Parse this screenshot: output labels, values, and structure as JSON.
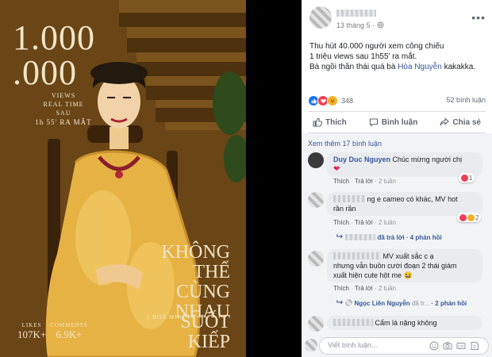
{
  "poster": {
    "big_line1": "1.000",
    "big_line2": ".000",
    "views_label": "VIEWS",
    "realtime_label": "REAL TIME",
    "sau_label": "SAU",
    "time_label": "1h 55' RA MẮT",
    "title_lines": [
      "KHÔNG",
      "THỂ",
      "CÙNG",
      "NHAU",
      "SUỐT",
      "KIẾP"
    ],
    "credit": "[ HOÀ MINZY ]",
    "likes_label": "LIKES",
    "likes_value": "107K+",
    "comments_label": "COMMENTS",
    "comments_value": "6.9K+"
  },
  "post": {
    "date": "13 tháng 5 ·",
    "text_line1": "Thu hút 40.000 người xem công chiếu",
    "text_line2": "1 triệu views sau 1h55' ra mắt.",
    "text_line3_prefix": "Bà ngồi thần thái quá bà ",
    "text_line3_tag": "Hòa Nguyễn",
    "text_line3_suffix": " kakakka.",
    "reaction_count": "348",
    "comment_count": "52 bình luận",
    "actions": {
      "like": "Thích",
      "comment": "Bình luận",
      "share": "Chia sẻ"
    }
  },
  "comments": {
    "see_more": "Xem thêm 17 bình luận",
    "c1": {
      "name": "Duy Duc Nguyen",
      "text": "Chúc mừng người chị",
      "like": "Thích",
      "reply": "Trả lời",
      "time": "2 tuần",
      "react_count": "1"
    },
    "c2": {
      "text_line1": "ng e cameo có khác, MV hot",
      "text_line2": "rần rần",
      "like": "Thích",
      "reply": "Trả lời",
      "time": "2 tuần",
      "react_count": "2",
      "reply_link_suffix": "đã trả lời",
      "replies": "4 phản hồi"
    },
    "c3": {
      "text_line1": "MV xuất sắc c ạ",
      "text_line2": "nhưng vẫn buồn cười đoạn 2 thái giám",
      "text_line3": "xuất hiện cute hột me",
      "like": "Thích",
      "reply": "Trả lời",
      "time": "2 tuần",
      "reply_name": "Ngọc Liên Nguyễn",
      "reply_suffix": "đã tr...",
      "replies": "2 phản hồi"
    },
    "c4": {
      "text": "Cẩm lá nặng không"
    }
  },
  "composer": {
    "placeholder": "Viết bình luận..."
  },
  "colors": {
    "fb_blue": "#385898",
    "like_blue": "#1877f2",
    "love_red": "#f33e58",
    "haha_yellow": "#f7b125"
  }
}
